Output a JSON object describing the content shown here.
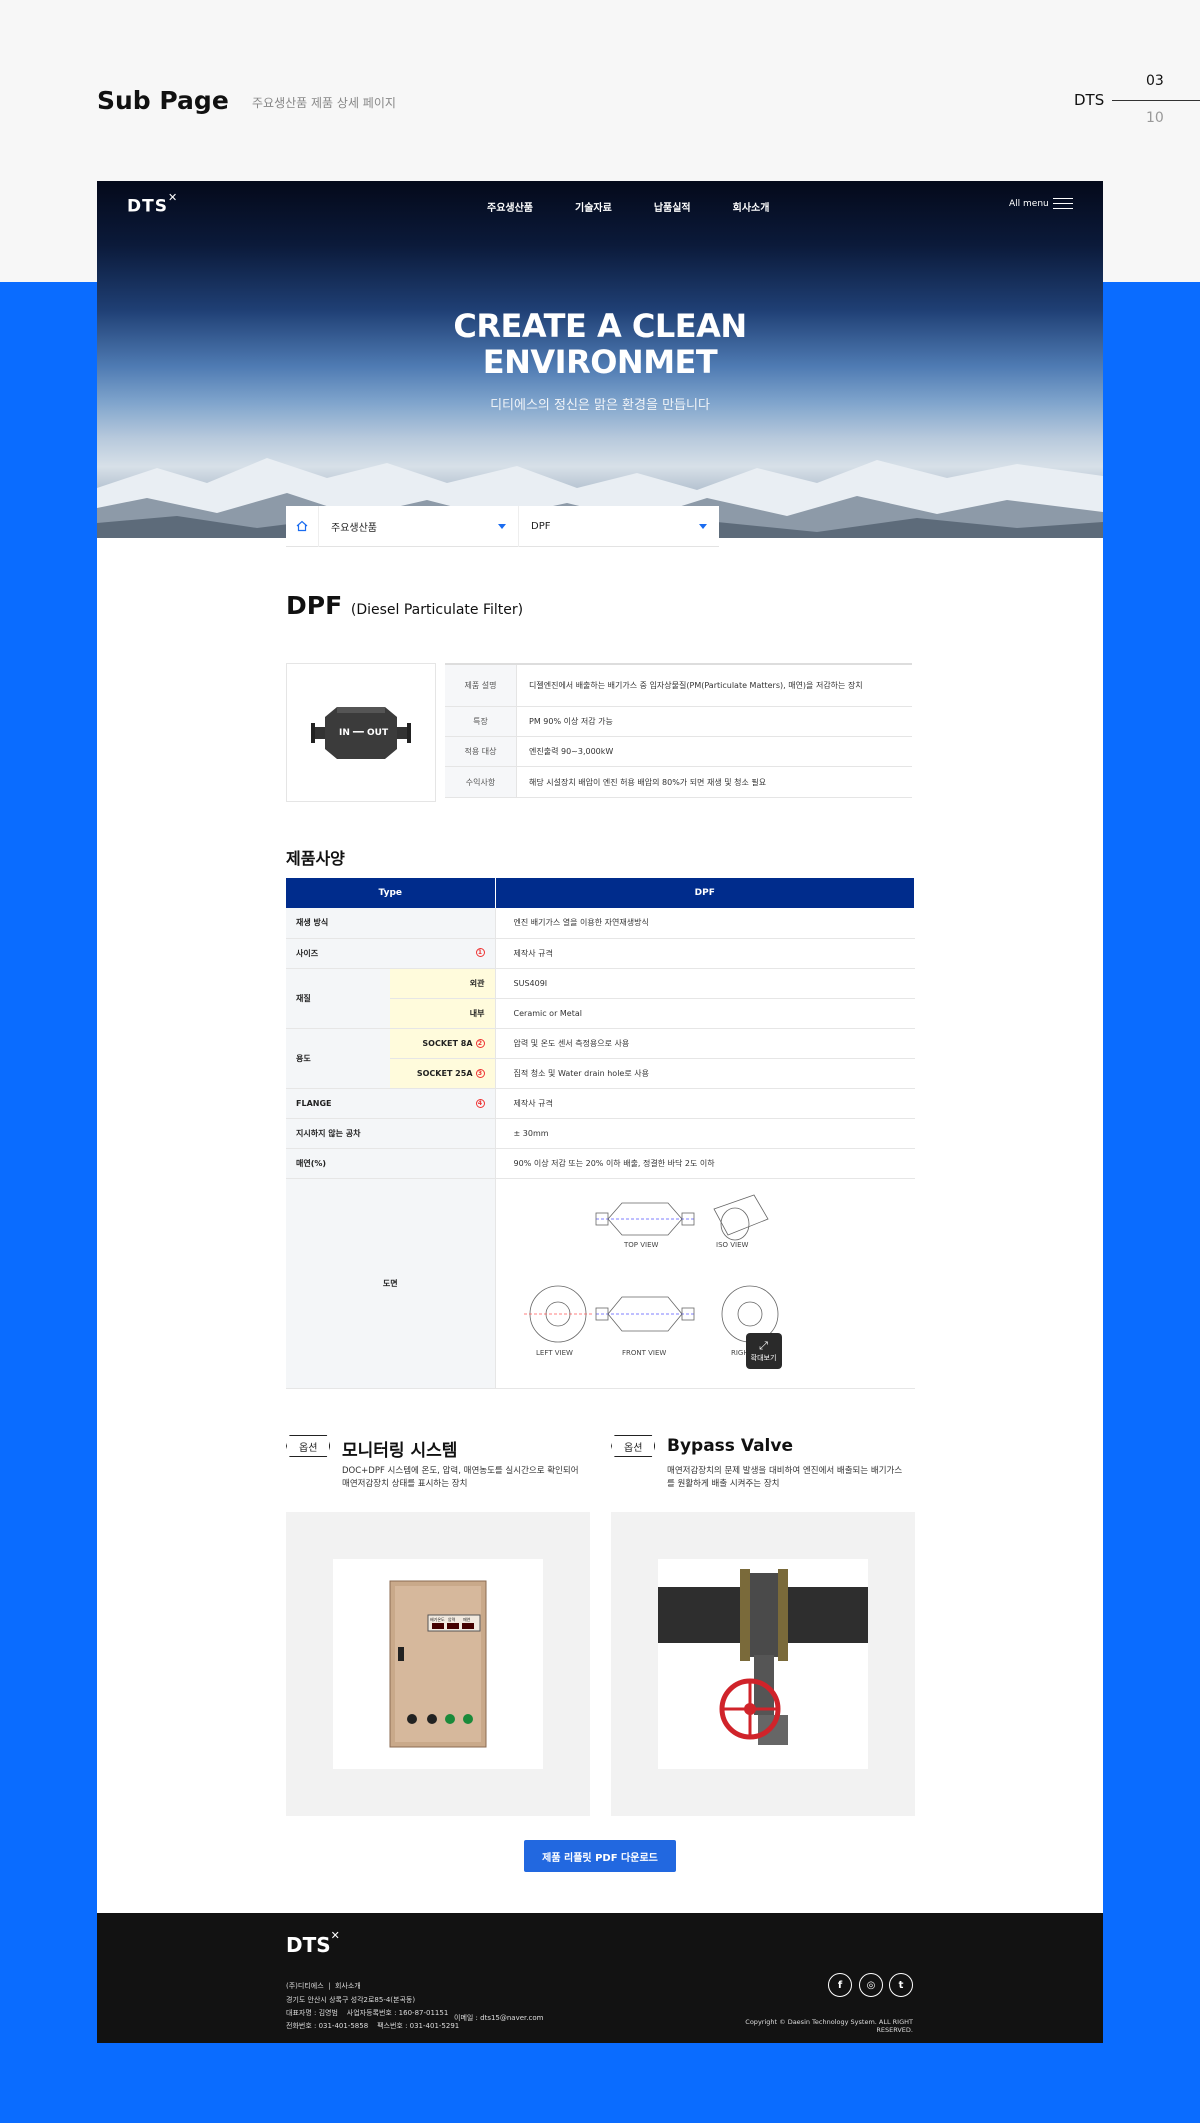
{
  "header": {
    "title": "Sub Page",
    "subtitle": "주요생산품 제품 상세 페이지",
    "brand": "DTS",
    "page_current": "03",
    "page_total": "10"
  },
  "site": {
    "logo": "DTS",
    "nav": [
      "주요생산품",
      "기술자료",
      "납품실적",
      "회사소개"
    ],
    "all_menu": "All menu",
    "hero_line1": "CREATE A CLEAN",
    "hero_line2": "ENVIRONMET",
    "hero_sub": "디티에스의 정신은 맑은 환경을 만듭니다"
  },
  "breadcrumb": {
    "level1": "주요생산품",
    "level2": "DPF"
  },
  "product": {
    "name": "DPF",
    "full_name": "(Diesel Particulate Filter)",
    "image_label": "IN ━━ OUT",
    "info": [
      {
        "key": "제품 설명",
        "value": "디젤엔진에서 배출하는 배기가스 중 입자상물질(PM(Particulate Matters), 매연)을 저감하는 장치"
      },
      {
        "key": "특장",
        "value": "PM 90% 이상 저감 가능"
      },
      {
        "key": "적용 대상",
        "value": "엔진출력 90~3,000kW"
      },
      {
        "key": "수익사항",
        "value": "해당 시설장치 배압이 엔진 허용 배압의 80%가 되면 재생 및 청소 필요"
      }
    ]
  },
  "spec": {
    "title": "제품사양",
    "col_type": "Type",
    "col_dpf": "DPF",
    "rows": {
      "regen": {
        "k": "재생 방식",
        "v": "엔진 배기가스 열을 이용한 자연재생방식"
      },
      "size": {
        "k": "사이즈",
        "n": "1",
        "v": "제작사 규격"
      },
      "material": {
        "k": "재질",
        "sub1": "외관",
        "v1": "SUS409I",
        "sub2": "내부",
        "v2": "Ceramic or Metal"
      },
      "use": {
        "k": "용도",
        "sub1": "SOCKET 8A",
        "n1": "2",
        "v1": "압력 및 온도 센서 측정용으로 사용",
        "sub2": "SOCKET 25A",
        "n2": "3",
        "v2": "집적 청소 및 Water drain hole로 사용"
      },
      "flange": {
        "k": "FLANGE",
        "n": "4",
        "v": "제작사 규격"
      },
      "tolerance": {
        "k": "지시하지 않는 공차",
        "v": "± 30mm"
      },
      "smoke": {
        "k": "매연(%)",
        "v": "90% 이상 저감 또는 20% 이하 배출, 정결한 바닥 2도 이하"
      },
      "drawing": {
        "k": "도면",
        "top": "TOP VIEW",
        "iso": "ISO VIEW",
        "left": "LEFT VIEW",
        "front": "FRONT VIEW",
        "right": "RIGHT VIEW",
        "zoom": "확대보기"
      }
    }
  },
  "options": [
    {
      "badge": "옵션",
      "title": "모니터링 시스템",
      "desc": "DOC+DPF 시스템에 온도, 압력, 매연농도를 실시간으로 확인되어 매연저감장치 상태를 표시하는 장치",
      "panel_labels": [
        "배기온도",
        "압력",
        "매연"
      ]
    },
    {
      "badge": "옵션",
      "title": "Bypass Valve",
      "desc": "매연저감장치의 문제 발생을 대비하여 엔진에서 배출되는 배기가스를 원활하게 배출 시켜주는 장치"
    }
  ],
  "download_label": "제품 리플릿 PDF 다운로드",
  "footer": {
    "logo": "DTS",
    "links": [
      "(주)디티에스",
      "회사소개"
    ],
    "address": "경기도 안산시 상록구 성각2로85-4(본곡동)",
    "ceo": "대표자명 : 김영범",
    "bizno": "사업자등록번호 : 160-87-01151",
    "tel": "전화번호 : 031-401-5858",
    "fax": "팩스번호 : 031-401-5291",
    "email": "이메일 : dts15@naver.com",
    "copyright": "Copyright © Daesin Technology System. ALL RIGHT RESERVED."
  }
}
